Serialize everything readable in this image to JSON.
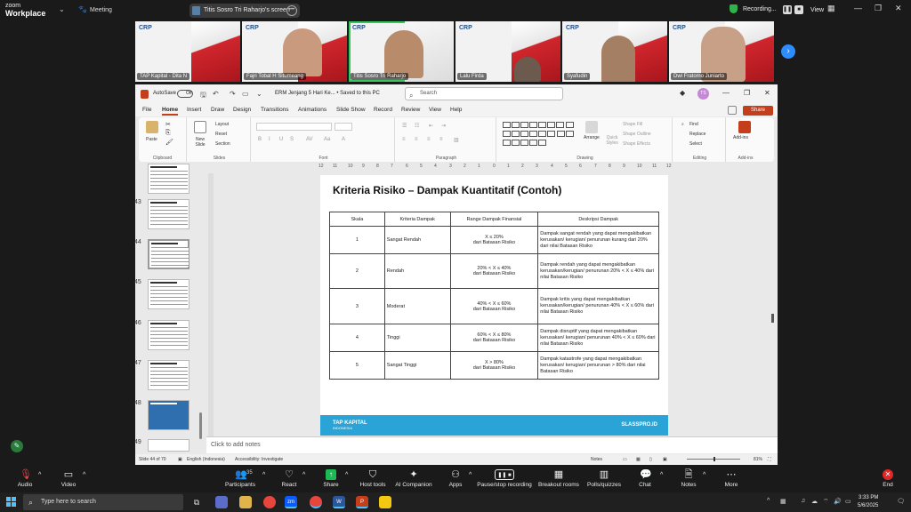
{
  "zoom": {
    "logo_line1": "zoom",
    "logo_line2": "Workplace",
    "meeting_label": "Meeting",
    "screen_share_label": "Titis Sosro Tri Raharjo's screen",
    "recording_label": "Recording...",
    "view_label": "View",
    "participants": [
      {
        "name": "TAP Kapital - Dita N"
      },
      {
        "name": "Fajri Tobal H Situmeang"
      },
      {
        "name": "Titis Sosro Tri Raharjo"
      },
      {
        "name": "Lalu Firda"
      },
      {
        "name": "Syafudin"
      },
      {
        "name": "Dwi Fratomo Juniarto"
      }
    ],
    "tile_logo": "CRP",
    "toolbar": {
      "audio": "Audio",
      "video": "Video",
      "participants": "Participants",
      "participants_count": "35",
      "react": "React",
      "share": "Share",
      "host_tools": "Host tools",
      "ai_companion": "AI Companion",
      "apps": "Apps",
      "pause_recording": "Pause/stop recording",
      "breakout": "Breakout rooms",
      "polls": "Polls/quizzes",
      "chat": "Chat",
      "notes": "Notes",
      "more": "More",
      "end": "End"
    }
  },
  "ppt": {
    "autosave": "AutoSave",
    "toggle": "Off",
    "doc_title": "ERM Jenjang 5 Hari Ke... • Saved to this PC",
    "search_placeholder": "Search",
    "avatar": "TS",
    "menus": [
      "File",
      "Home",
      "Insert",
      "Draw",
      "Design",
      "Transitions",
      "Animations",
      "Slide Show",
      "Record",
      "Review",
      "View",
      "Help"
    ],
    "active_menu": "Home",
    "share": "Share",
    "ribbon": {
      "paste": "Paste",
      "clipboard": "Clipboard",
      "new_slide": "New Slide",
      "layout": "Layout",
      "reset": "Reset",
      "section": "Section",
      "slides": "Slides",
      "font": "Font",
      "paragraph": "Paragraph",
      "arrange": "Arrange",
      "quick_styles": "Quick Styles",
      "shape_fill": "Shape Fill",
      "shape_outline": "Shape Outline",
      "shape_effects": "Shape Effects",
      "drawing": "Drawing",
      "find": "Find",
      "replace": "Replace",
      "select": "Select",
      "editing": "Editing",
      "addins": "Add-ins",
      "addins_group": "Add-ins"
    },
    "thumb_numbers": [
      "43",
      "44",
      "45",
      "46",
      "47",
      "48",
      "49"
    ],
    "ruler_ticks": [
      "12",
      "11",
      "10",
      "9",
      "8",
      "7",
      "6",
      "5",
      "4",
      "3",
      "2",
      "1",
      "0",
      "1",
      "2",
      "3",
      "4",
      "5",
      "6",
      "7",
      "8",
      "9",
      "10",
      "11",
      "12"
    ],
    "notes_placeholder": "Click to add notes",
    "status": {
      "slide": "Slide 44 of 70",
      "language": "English (Indonesia)",
      "accessibility": "Accessibility: Investigate",
      "notes": "Notes",
      "zoom": "81%"
    }
  },
  "slide": {
    "title": "Kriteria Risiko – Dampak Kuantitatif (Contoh)",
    "headers": [
      "Skala",
      "Kriteria Dampak",
      "Range Dampak Finansial",
      "Deskripsi Dampak"
    ],
    "rows": [
      {
        "skala": "1",
        "kriteria": "Sangat Rendah",
        "range1": "X ≤ 20%",
        "range2": "dari Batasan Risiko",
        "desc": "Dampak sangat rendah yang dapat mengakibatkan kerusakan/ kerugian/ penurunan kurang dari 20% dari nilai Batasan Risiko"
      },
      {
        "skala": "2",
        "kriteria": "Rendah",
        "range1": "20% < X ≤ 40%",
        "range2": "dari Batasan Risiko",
        "desc": "Dampak rendah yang dapat mengakibatkan kerusakan/kerugian/ penurunan 20% < X ≤ 40% dari nilai Batasan Risiko"
      },
      {
        "skala": "3",
        "kriteria": "Moderat",
        "range1": "40% < X ≤ 60%",
        "range2": "dari Batasan Risiko",
        "desc": "Dampak kritis yang dapat mengakibatkan kerusakan/kerugian/ penurunan 40% < X ≤ 60% dari nilai Batasan Risiko"
      },
      {
        "skala": "4",
        "kriteria": "Tinggi",
        "range1": "60% < X ≤ 80%",
        "range2": "dari Batasan Risiko",
        "desc": "Dampak disruptif yang dapat mengakibatkan kerusakan/ kerugian/ penurunan 40% < X ≤ 60% dari nilai Batasan Risiko"
      },
      {
        "skala": "5",
        "kriteria": "Sangat Tinggi",
        "range1": "X > 80%",
        "range2": "dari Batasan Risiko",
        "desc": "Dampak katastrofe yang dapat mengakibatkan kerusakan/ kerugian/ penurunan > 80% dari nilai Batasan Risiko"
      }
    ],
    "footer_logo": "TAP KAPITAL",
    "footer_logo_sub": "INDONESIA",
    "footer_right": "SLASSPRO.ID",
    "footer_color": "#2aa3d6"
  },
  "taskbar": {
    "search_placeholder": "Type here to search",
    "time": "3:33 PM",
    "date": "5/6/2025",
    "accent": "#4cc2ff"
  }
}
